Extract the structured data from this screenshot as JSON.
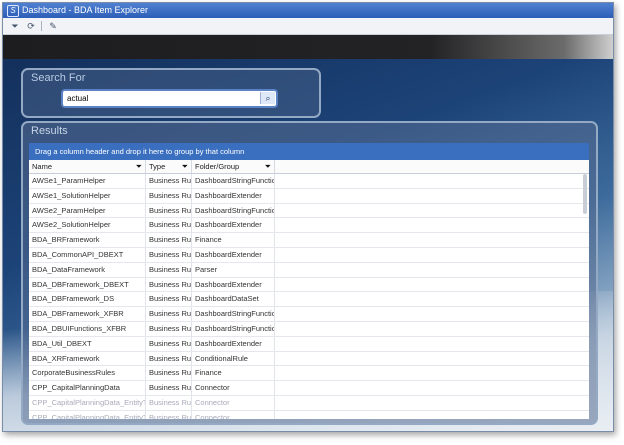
{
  "window": {
    "title": "Dashboard - BDA Item Explorer"
  },
  "toolbar": {
    "icons": [
      "filter-icon",
      "refresh-icon",
      "pencil-icon"
    ]
  },
  "search": {
    "label": "Search For",
    "value": "actual",
    "button_icon": "search-icon"
  },
  "results": {
    "label": "Results",
    "group_hint": "Drag a column header and drop it here to group by that column",
    "columns": [
      "Name",
      "Type",
      "Folder/Group"
    ],
    "rows": [
      [
        "AWSe1_ParamHelper",
        "Business Rule",
        "DashboardStringFunction"
      ],
      [
        "AWSe1_SolutionHelper",
        "Business Rule",
        "DashboardExtender"
      ],
      [
        "AWSe2_ParamHelper",
        "Business Rule",
        "DashboardStringFunction"
      ],
      [
        "AWSe2_SolutionHelper",
        "Business Rule",
        "DashboardExtender"
      ],
      [
        "BDA_BRFramework",
        "Business Rule",
        "Finance"
      ],
      [
        "BDA_CommonAPI_DBEXT",
        "Business Rule",
        "DashboardExtender"
      ],
      [
        "BDA_DataFramework",
        "Business Rule",
        "Parser"
      ],
      [
        "BDA_DBFramework_DBEXT",
        "Business Rule",
        "DashboardExtender"
      ],
      [
        "BDA_DBFramework_DS",
        "Business Rule",
        "DashboardDataSet"
      ],
      [
        "BDA_DBFramework_XFBR",
        "Business Rule",
        "DashboardStringFunction"
      ],
      [
        "BDA_DBUIFunctions_XFBR",
        "Business Rule",
        "DashboardStringFunction"
      ],
      [
        "BDA_Util_DBEXT",
        "Business Rule",
        "DashboardExtender"
      ],
      [
        "BDA_XRFramework",
        "Business Rule",
        "ConditionalRule"
      ],
      [
        "CorporateBusinessRules",
        "Business Rule",
        "Finance"
      ],
      [
        "CPP_CapitalPlanningData",
        "Business Rule",
        "Connector"
      ],
      [
        "CPP_CapitalPlanningData_EntityTin",
        "Business Rule",
        "Connector"
      ],
      [
        "CPP_CapitalPlanningData_EntityTout",
        "Business Rule",
        "Connector"
      ]
    ]
  },
  "colors": {
    "accent": "#3a6fbf",
    "titlebar": "#2c5fb8"
  }
}
